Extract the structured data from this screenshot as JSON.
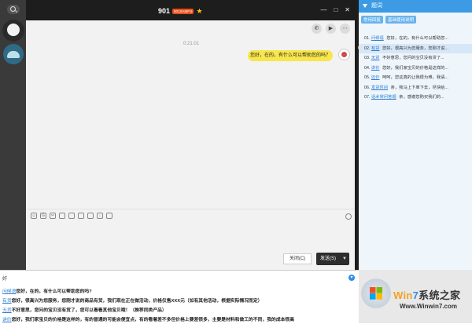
{
  "window": {
    "title": "901",
    "badge": "901SAMP.9",
    "controls": [
      "—",
      "□",
      "✕"
    ]
  },
  "chat": {
    "timestamp": "0:21:01",
    "bubble": "您好，在的，有什么可以帮助您的吗？",
    "top_icons": [
      "phone-icon",
      "video-icon",
      "more-icon"
    ]
  },
  "input": {
    "close_label": "关闭(C)",
    "send_label": "发送(S)",
    "send_arrow": "▼"
  },
  "quick_reply": {
    "header": "题词",
    "tabs": [
      "常用回复",
      "基础使用说明"
    ],
    "items": [
      {
        "num": "01.",
        "key": "问候语",
        "text": "您好，在的，有什么可以帮助您..."
      },
      {
        "num": "02.",
        "key": "有货",
        "text": "您好，很高兴为您服务，您刚才说..."
      },
      {
        "num": "03.",
        "key": "无货",
        "text": "不好意思，您问的宝贝没有货了..."
      },
      {
        "num": "04.",
        "key": "讲价",
        "text": "您好，我们家宝贝的价格是这样的..."
      },
      {
        "num": "05.",
        "key": "还价",
        "text": "呵呵，您这真的让我很为难，我请..."
      },
      {
        "num": "06.",
        "key": "发货时间",
        "text": "亲，我马上下单下去，尽快给..."
      },
      {
        "num": "07.",
        "key": "话术常问答题",
        "text": "亲，感谢您购买我们的..."
      }
    ]
  },
  "editor": {
    "typed": "好",
    "lines": [
      {
        "key": "问候语",
        "text": "您好，在的，有什么可以帮助您的吗?"
      },
      {
        "key": "有货",
        "text": "您好，很高兴为您服务，您刚才说的商品有货，我们现在正在做活动，价格仅售XXX元（如有其他活动，根据实际情况而定）"
      },
      {
        "key": "无货",
        "text": "不好意思，您问的宝贝没有货了，您可以看看其他宝贝哦！（推荐同类产品）"
      },
      {
        "key": "讲价",
        "text": "您好，我们家宝贝的价格是这样的，有的普通的可能会便宜点，有的看着差不多但价格上要差很多，主要是材料和做工的不同，我的成本很高"
      }
    ]
  },
  "watermark": {
    "brand_win": "Win",
    "brand_7": "7",
    "brand_rest": "系统之家",
    "url": "Www.Winwin7.com"
  }
}
